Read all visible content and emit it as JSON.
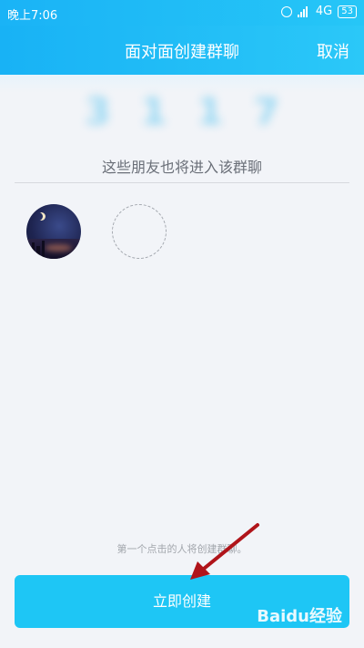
{
  "status_bar": {
    "time": "晚上7:06",
    "network": "4G",
    "battery": "53"
  },
  "header": {
    "title": "面对面创建群聊",
    "cancel_label": "取消"
  },
  "room_code": "3117",
  "hint": "这些朋友也将进入该群聊",
  "footer_note": "第一个点击的人将创建群聊。",
  "create_button_label": "立即创建",
  "watermark": "Baidu经验",
  "colors": {
    "accent": "#1ec6f5",
    "header": "#18b2f5"
  },
  "icons": [
    "alarm-icon",
    "signal-icon",
    "battery-icon",
    "arrow-icon"
  ]
}
